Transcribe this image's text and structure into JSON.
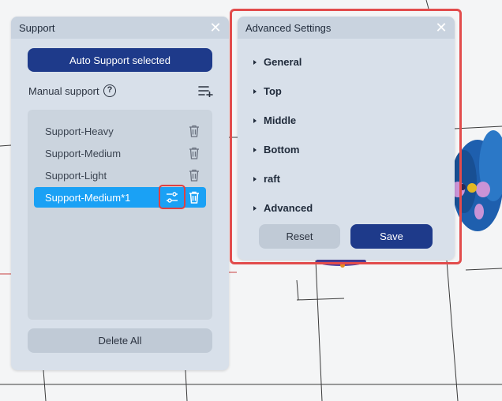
{
  "support_panel": {
    "title": "Support",
    "auto_button": "Auto Support selected",
    "manual_label": "Manual support",
    "help_glyph": "?",
    "items": [
      {
        "label": "Support-Heavy",
        "selected": false
      },
      {
        "label": "Support-Medium",
        "selected": false
      },
      {
        "label": "Support-Light",
        "selected": false
      },
      {
        "label": "Support-Medium*1",
        "selected": true
      }
    ],
    "delete_all": "Delete All"
  },
  "advanced_panel": {
    "title": "Advanced Settings",
    "sections": [
      "General",
      "Top",
      "Middle",
      "Bottom",
      "raft",
      "Advanced"
    ],
    "reset_label": "Reset",
    "save_label": "Save"
  },
  "icons": {
    "close": "close-icon",
    "help": "help-circle-icon",
    "add_list": "list-add-icon",
    "trash": "trash-icon",
    "adjust": "sliders-icon",
    "section_arrow": "caret-right-icon"
  },
  "colors": {
    "primary_button": "#1e3a8a",
    "selected_item": "#1aa1f5",
    "highlight": "#e24c4c",
    "panel_bg": "#d8e0ea"
  }
}
